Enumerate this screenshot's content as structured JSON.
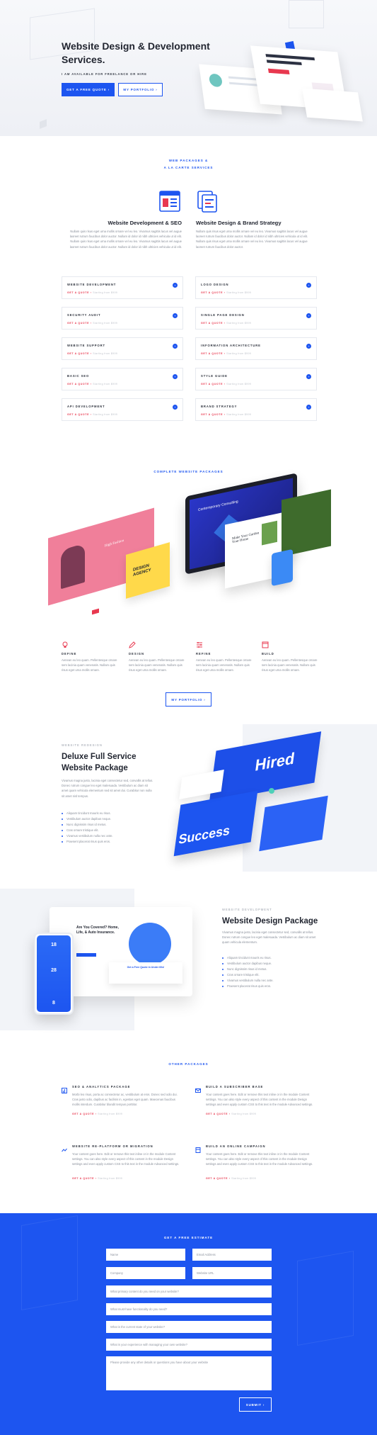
{
  "hero": {
    "title": "Website Design & Development Services.",
    "subtitle": "I AM AVAILABLE FOR FREELANCE OR HIRE",
    "btn_quote": "GET A FREE QUOTE",
    "btn_portfolio": "MY PORTFOLIO"
  },
  "packages": {
    "heading_line1": "WEB PACKAGES &",
    "heading_line2": "A LA CARTE SERVICES",
    "left": {
      "title": "Website Development & SEO",
      "text": "Nullam quis risus eget urna mollis ornare vel eu leo. Vivamus sagittis lacus vel augue laoreet rutrum faucibus dolor auctor. Nullam id dolor id nibh ultricies vehicula ut id elit. Nullam quis risus eget urna mollis ornare vel eu leo. Vivamus sagittis lacus vel augue laoreet rutrum faucibus dolor auctor. Nullam id dolor id nibh ultricies vehicula ut id elit."
    },
    "right": {
      "title": "Website Design & Brand Strategy",
      "text": "Nullam quis risus eget urna mollis ornare vel eu leo. Vivamus sagittis lacus vel augue laoreet rutrum faucibus dolor auctor. Nullam id dolor id nibh ultricies vehicula ut id elit. Nullam quis risus eget urna mollis ornare vel eu leo. Vivamus sagittis lacus vel augue laoreet rutrum faucibus dolor auctor."
    },
    "quote": "GET A QUOTE",
    "price": "Starting from $999",
    "items_left": [
      "WEBSITE DEVELOPMENT",
      "SECURITY AUDIT",
      "WEBSITE SUPPORT",
      "BASIC SEO",
      "API DEVELOPMENT"
    ],
    "items_right": [
      "LOGO DESIGN",
      "SINGLE PAGE DESIGN",
      "INFORMATION ARCHITECTURE",
      "STYLE GUIDE",
      "BRAND STRATEGY"
    ]
  },
  "complete": {
    "heading": "COMPLETE WEBSITE PACKAGES",
    "mock1": "High Fashion",
    "mock2": "DESIGN AGENCY",
    "mock3": "Contemporary Consulting",
    "mock4": "Make Your Garden Your Home",
    "steps": [
      {
        "label": "DEFINE",
        "text": "Aenean eu leo quam. Pellentesque ornare sem lacinia quam venenatis. Nullam quis risus eget urna mollis ornare."
      },
      {
        "label": "DESIGN",
        "text": "Aenean eu leo quam. Pellentesque ornare sem lacinia quam venenatis. Nullam quis risus eget urna mollis ornare."
      },
      {
        "label": "REFINE",
        "text": "Aenean eu leo quam. Pellentesque ornare sem lacinia quam venenatis. Nullam quis risus eget urna mollis ornare."
      },
      {
        "label": "BUILD",
        "text": "Aenean eu leo quam. Pellentesque ornare sem lacinia quam venenatis. Nullam quis risus eget urna mollis ornare."
      }
    ],
    "btn": "MY PORTFOLIO"
  },
  "deluxe": {
    "eyebrow": "WEBSITE REDESIGN",
    "title": "Deluxe Full Service Website Package",
    "text": "Vivamus magna justo, lacinia eget consectetur sed, convallis at tellus. Donec rutrum congue leo eget malesuada. Vestibulum ac diam sit amet quam vehicula elementum sed sit amet dui. Curabitur non nulla sit amet nisl tempus.",
    "bullets": [
      "Aliquam tincidunt mauris eu risus.",
      "Vestibulum auctor dapibus neque.",
      "Nunc dignissim risus id metus.",
      "Cras ornare tristique elit.",
      "Vivamus vestibulum nulla nec ante.",
      "Praesent placerat risus quis eros."
    ],
    "art1": "Hired",
    "art2": "Success"
  },
  "design": {
    "eyebrow": "WEBSITE DEVELOPMENT",
    "title": "Website Design Package",
    "text": "Vivamus magna justo, lacinia eget consectetur sed, convallis at tellus. Donec rutrum congue leo eget malesuada. Vestibulum ac diam sit amet quam vehicula elementum.",
    "bullets": [
      "Aliquam tincidunt mauris eu risus.",
      "Vestibulum auctor dapibus neque.",
      "Nunc dignissim risus id metus.",
      "Cras ornare tristique elit.",
      "Vivamus vestibulum nulla nec ante.",
      "Praesent placerat risus quis eros."
    ],
    "phone": [
      "18",
      "28",
      "8"
    ],
    "laptop_title": "Are You Covered? Home, Life, & Auto Insurance.",
    "laptop_sub": "Get a Free Quote in Under 60s!"
  },
  "other": {
    "heading": "OTHER PACKAGES",
    "text": "Your content goes here. Edit or remove this text inline or in the module Content settings. You can also style every aspect of this content in the module Design settings and even apply custom CSS to this text in the module Advanced settings.",
    "items": [
      {
        "title": "SEO & ANALYTICS PACKAGE"
      },
      {
        "title": "BUILD A SUBSCRIBER BASE"
      },
      {
        "title": "WEBSITE RE-PLATFORM OR MIGRATION"
      },
      {
        "title": "BUILD AN ONLINE CAMPAIGN"
      }
    ],
    "first_text": "Morbi leo risus, porta ac consectetur ac, vestibulum at eros. Donec sed odio dui. Cras justo odio, dapibus ac facilisis in, egestas eget quam. Maecenas faucibus mollis interdum. Curabitur blandit tempus porttitor."
  },
  "estimate": {
    "heading": "GET A FREE ESTIMATE",
    "name": "Name",
    "email": "Email Address",
    "company": "Company",
    "url": "Website URL",
    "q1": "What primary content do you need on your website?",
    "q2": "What must-have functionality do you need?",
    "q3": "What is the current state of your website?",
    "q4": "What is your experience with managing your own website?",
    "message": "Please provide any other details or questions you have about your website",
    "submit": "SUBMIT"
  },
  "colors": {
    "accent": "#1d55f0",
    "red": "#e8384f"
  }
}
